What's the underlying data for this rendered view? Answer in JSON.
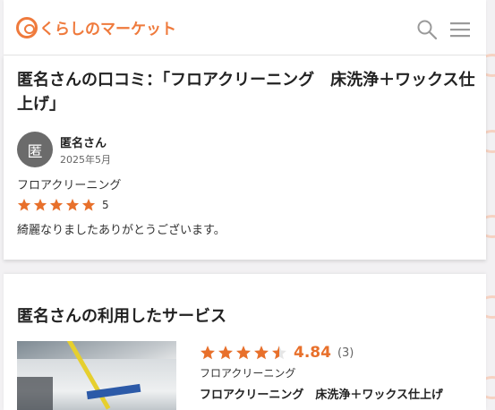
{
  "header": {
    "logo_text": "くらしのマーケット",
    "search_icon": "search-icon",
    "menu_icon": "hamburger-menu-icon"
  },
  "colors": {
    "brand": "#ef7a3c",
    "star": "#e8702b",
    "avatar_bg": "#6b6b6b"
  },
  "review": {
    "title": "匿名さんの口コミ：「フロアクリーニング　床洗浄＋ワックス仕上げ」",
    "avatar_char": "匿",
    "author": "匿名さん",
    "date": "2025年5月",
    "service": "フロアクリーニング",
    "stars": 5,
    "rating": "5",
    "comment": "綺麗なりましたありがとうございます。"
  },
  "used_service": {
    "section_title": "匿名さんの利用したサービス",
    "stars": 4.5,
    "score": "4.84",
    "count": "(3)",
    "category": "フロアクリーニング",
    "name": "フロアクリーニング　床洗浄＋ワックス仕上げ"
  }
}
